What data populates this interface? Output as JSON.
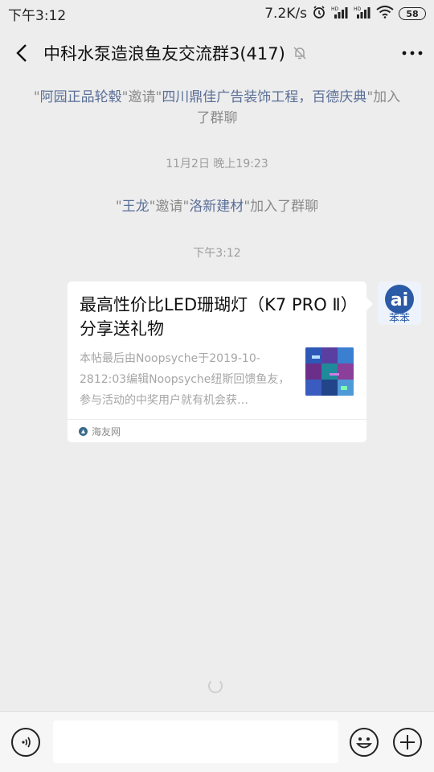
{
  "status_bar": {
    "time": "下午3:12",
    "network_speed": "7.2K/s",
    "alarm_icon": "alarm-icon",
    "signal_1": "signal-hd-icon",
    "signal_2": "signal-hd-icon",
    "wifi_icon": "wifi-icon",
    "battery": "58"
  },
  "header": {
    "back_icon": "back-arrow-icon",
    "title": "中科水泵造浪鱼友交流群3(417)",
    "mute_icon": "muted-bell-icon",
    "more_icon": "more-dots-icon"
  },
  "messages": {
    "sys1": {
      "q1": "\"",
      "inviter": "阿园正品轮毂",
      "mid": "\"邀请\"",
      "invitee": "四川鼎佳广告装饰工程，百德庆典",
      "tail": "\"加入了群聊"
    },
    "stamp1": "11月2日 晚上19:23",
    "sys2": {
      "q1": "\"",
      "inviter": "王龙",
      "mid": "\"邀请\"",
      "invitee": "洛新建材",
      "tail": "\"加入了群聊"
    },
    "stamp2": "下午3:12",
    "card": {
      "title": "最高性价比LED珊瑚灯（K7 PRO Ⅱ）分享送礼物",
      "description": "本帖最后由Noopsyche于2019-10-2812:03编辑Noopsyche纽斯回馈鱼友，参与活动的中奖用户就有机会获…",
      "source": "海友网"
    },
    "avatar_text": "苯苯"
  },
  "input_bar": {
    "voice_icon": "voice-icon",
    "input_value": "",
    "emoji_icon": "emoji-icon",
    "plus_icon": "plus-icon"
  }
}
